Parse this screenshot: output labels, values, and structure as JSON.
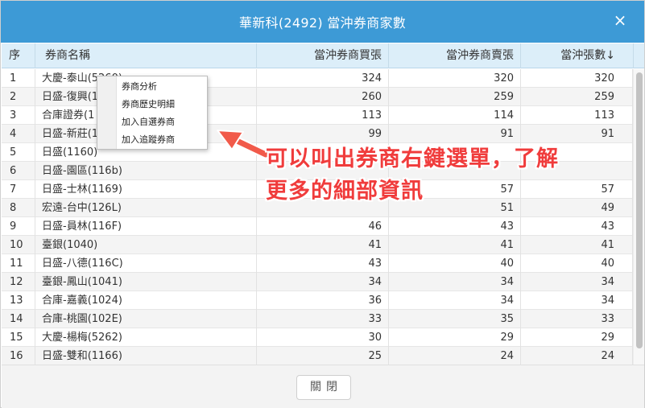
{
  "dialog": {
    "title": "華新科(2492) 當沖券商家數",
    "close_icon": "close-icon",
    "close_button_label": "關閉"
  },
  "table": {
    "columns": [
      "序",
      "券商名稱",
      "當沖券商買張",
      "當沖券商賣張",
      "當沖張數"
    ],
    "sort_indicator": "↓",
    "rows": [
      {
        "idx": "1",
        "name": "大慶-泰山(5260)",
        "buy": "324",
        "sell": "320",
        "count": "320"
      },
      {
        "idx": "2",
        "name": "日盛-復興(1",
        "buy": "260",
        "sell": "259",
        "count": "259"
      },
      {
        "idx": "3",
        "name": "合庫證券(1",
        "buy": "113",
        "sell": "114",
        "count": "113"
      },
      {
        "idx": "4",
        "name": "日盛-新莊(1",
        "buy": "99",
        "sell": "91",
        "count": "91"
      },
      {
        "idx": "5",
        "name": "日盛(1160)",
        "buy": "",
        "sell": "",
        "count": ""
      },
      {
        "idx": "6",
        "name": "日盛-園區(116b)",
        "buy": "",
        "sell": "",
        "count": ""
      },
      {
        "idx": "7",
        "name": "日盛-士林(1169)",
        "buy": "",
        "sell": "57",
        "count": "57"
      },
      {
        "idx": "8",
        "name": "宏遠-台中(126L)",
        "buy": "",
        "sell": "51",
        "count": "49"
      },
      {
        "idx": "9",
        "name": "日盛-員林(116F)",
        "buy": "46",
        "sell": "43",
        "count": "43"
      },
      {
        "idx": "10",
        "name": "臺銀(1040)",
        "buy": "41",
        "sell": "41",
        "count": "41"
      },
      {
        "idx": "11",
        "name": "日盛-八德(116C)",
        "buy": "43",
        "sell": "40",
        "count": "40"
      },
      {
        "idx": "12",
        "name": "臺銀-鳳山(1041)",
        "buy": "34",
        "sell": "34",
        "count": "34"
      },
      {
        "idx": "13",
        "name": "合庫-嘉義(1024)",
        "buy": "36",
        "sell": "34",
        "count": "34"
      },
      {
        "idx": "14",
        "name": "合庫-桃園(102E)",
        "buy": "33",
        "sell": "35",
        "count": "33"
      },
      {
        "idx": "15",
        "name": "大慶-楊梅(5262)",
        "buy": "30",
        "sell": "29",
        "count": "29"
      },
      {
        "idx": "16",
        "name": "日盛-雙和(1166)",
        "buy": "25",
        "sell": "24",
        "count": "24"
      }
    ]
  },
  "context_menu": {
    "items": [
      "券商分析",
      "券商歷史明細",
      "加入自選券商",
      "加入追蹤券商"
    ]
  },
  "annotation": {
    "line1": "可以叫出券商右鍵選單，了解",
    "line2": "更多的細部資訊",
    "color": "#f03c3c"
  },
  "colors": {
    "titlebar": "#3d9ad6",
    "header": "#dceef9"
  }
}
